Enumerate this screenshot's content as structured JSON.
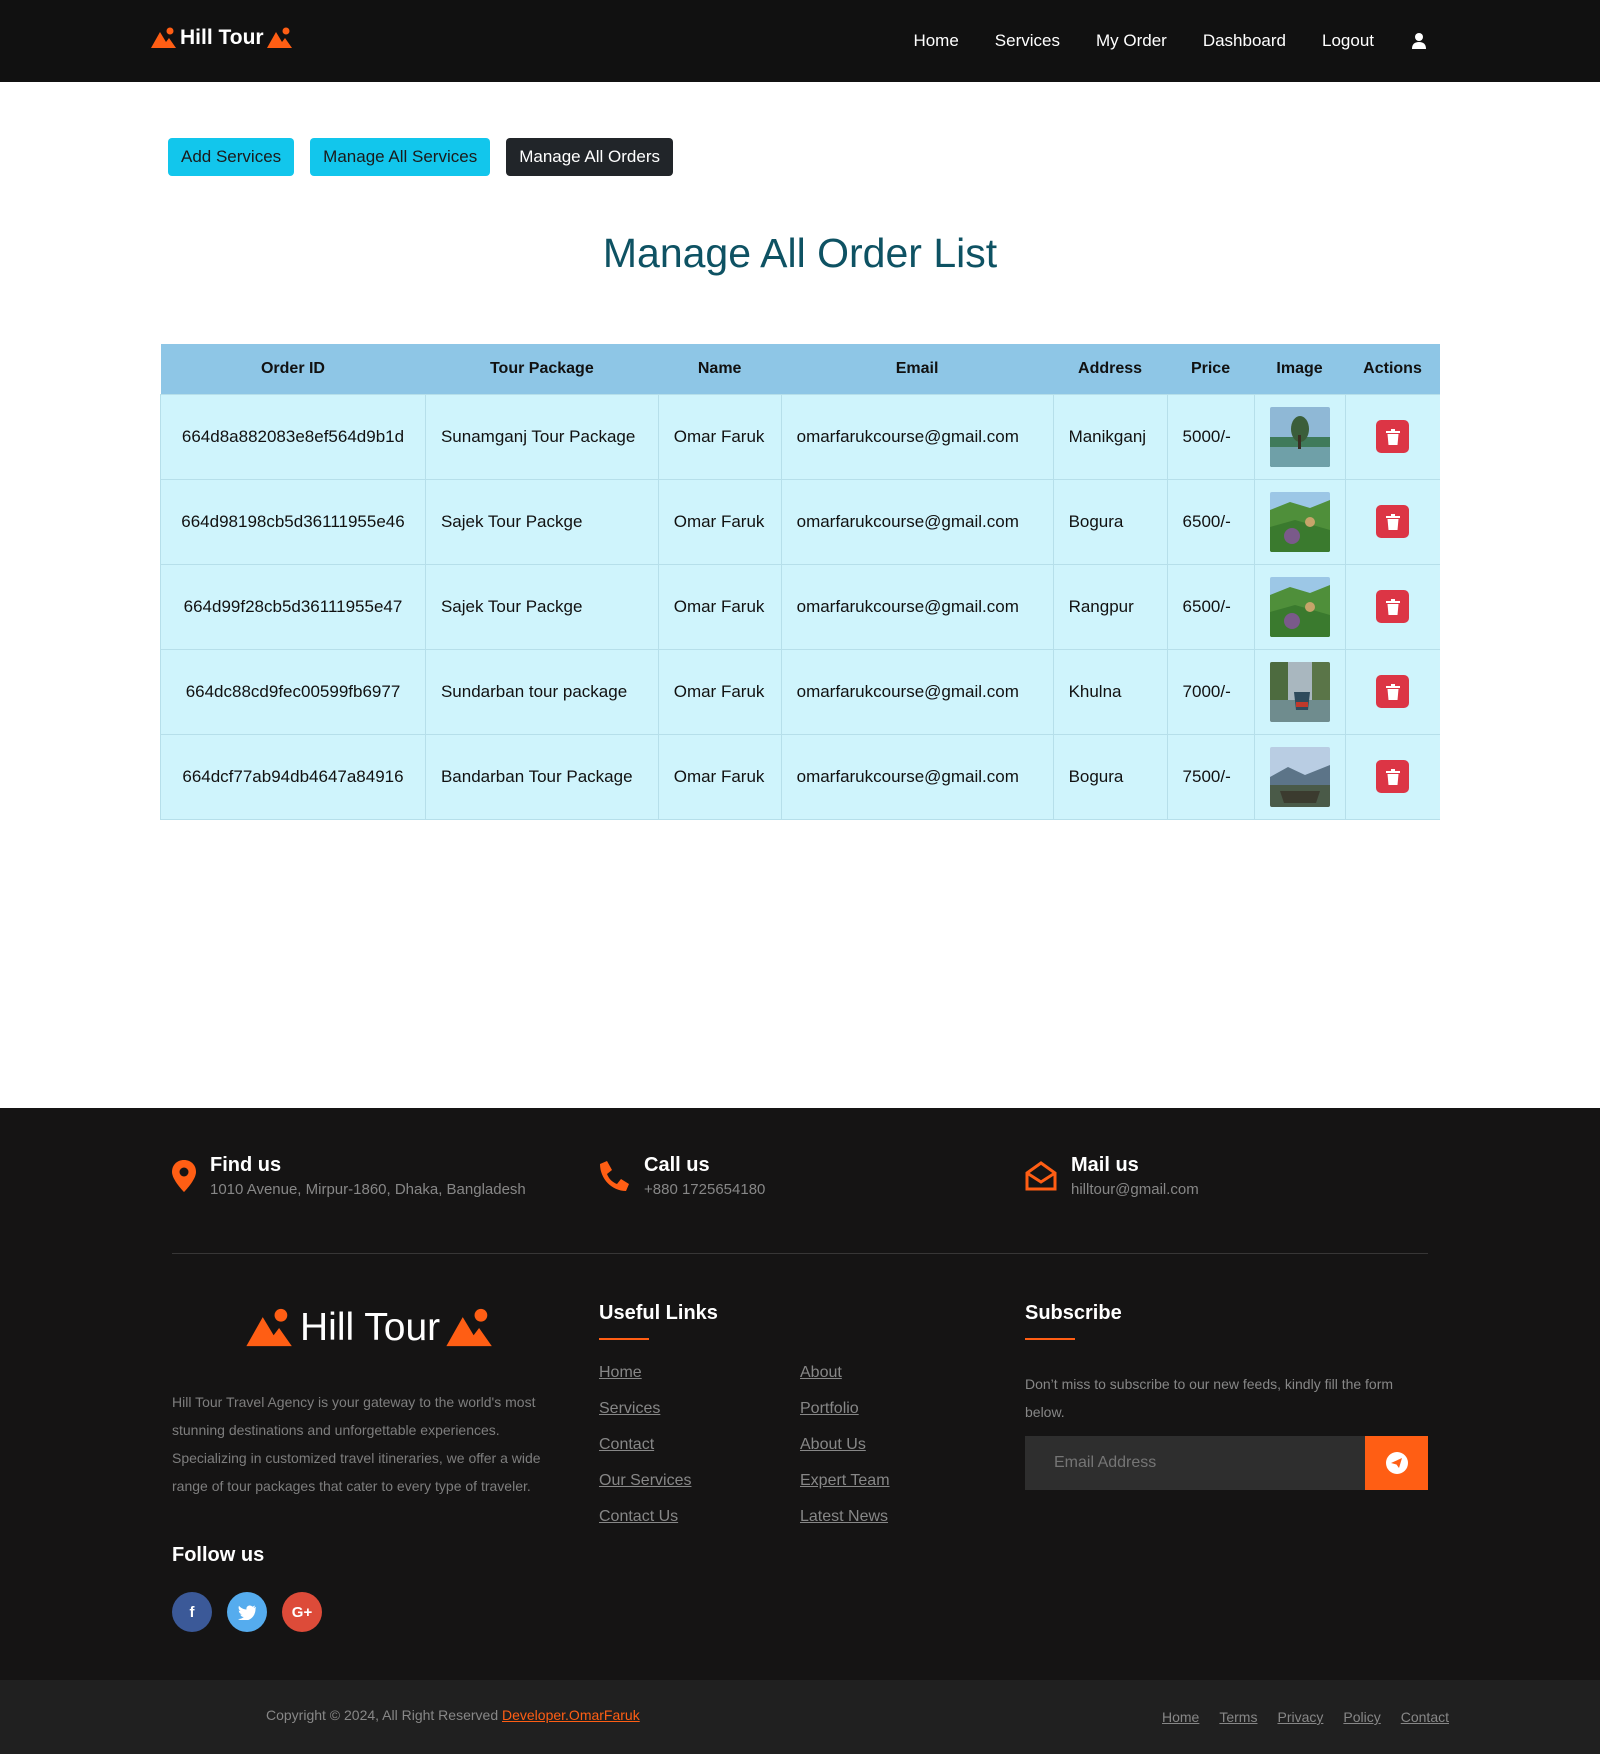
{
  "nav": {
    "brand": "Hill Tour",
    "links": [
      "Home",
      "Services",
      "My Order",
      "Dashboard",
      "Logout"
    ]
  },
  "admin": {
    "buttons": [
      "Add Services",
      "Manage All Services",
      "Manage All Orders"
    ]
  },
  "page_title": "Manage All Order List",
  "table": {
    "headers": [
      "Order ID",
      "Tour Package",
      "Name",
      "Email",
      "Address",
      "Price",
      "Image",
      "Actions"
    ],
    "rows": [
      {
        "id": "664d8a882083e8ef564d9b1d",
        "package": "Sunamganj Tour Package",
        "name": "Omar Faruk",
        "email": "omarfarukcourse@gmail.com",
        "address": "Manikganj",
        "price": "5000/-",
        "image": "lake-tree-photo"
      },
      {
        "id": "664d98198cb5d36111955e46",
        "package": "Sajek Tour Packge",
        "name": "Omar Faruk",
        "email": "omarfarukcourse@gmail.com",
        "address": "Bogura",
        "price": "6500/-",
        "image": "sajek-hills-photo"
      },
      {
        "id": "664d99f28cb5d36111955e47",
        "package": "Sajek Tour Packge",
        "name": "Omar Faruk",
        "email": "omarfarukcourse@gmail.com",
        "address": "Rangpur",
        "price": "6500/-",
        "image": "sajek-hills-photo"
      },
      {
        "id": "664dc88cd9fec00599fb6977",
        "package": "Sundarban tour package",
        "name": "Omar Faruk",
        "email": "omarfarukcourse@gmail.com",
        "address": "Khulna",
        "price": "7000/-",
        "image": "river-boat-photo"
      },
      {
        "id": "664dcf77ab94db4647a84916",
        "package": "Bandarban Tour Package",
        "name": "Omar Faruk",
        "email": "omarfarukcourse@gmail.com",
        "address": "Bogura",
        "price": "7500/-",
        "image": "mountain-boat-photo"
      }
    ]
  },
  "footer": {
    "find_us": {
      "title": "Find us",
      "text": "1010 Avenue, Mirpur-1860, Dhaka, Bangladesh"
    },
    "call_us": {
      "title": "Call us",
      "text": "+880 1725654180"
    },
    "mail_us": {
      "title": "Mail us",
      "text": "hilltour@gmail.com"
    },
    "brand": "Hill Tour",
    "description": "Hill Tour Travel Agency is your gateway to the world's most stunning destinations and unforgettable experiences. Specializing in customized travel itineraries, we offer a wide range of tour packages that cater to every type of traveler.",
    "follow_us": "Follow us",
    "useful_links_title": "Useful Links",
    "links_col1": [
      "Home",
      "Services",
      "Contact",
      "Our Services",
      "Contact Us"
    ],
    "links_col2": [
      "About",
      "Portfolio",
      "About Us",
      "Expert Team",
      "Latest News"
    ],
    "subscribe_title": "Subscribe",
    "subscribe_text": "Don’t miss to subscribe to our new feeds, kindly fill the form below.",
    "email_placeholder": "Email Address",
    "copyright": "Copyright © 2024, All Right Reserved",
    "developer": "Developer.OmarFaruk",
    "bottom_links": [
      "Home",
      "Terms",
      "Privacy",
      "Policy",
      "Contact"
    ]
  },
  "colors": {
    "accent": "#ff5e14",
    "info_button": "#12c6ec",
    "table_header": "#8ec6e6",
    "table_row": "#cff4fc",
    "title": "#0e5263",
    "delete": "#dc3545"
  }
}
